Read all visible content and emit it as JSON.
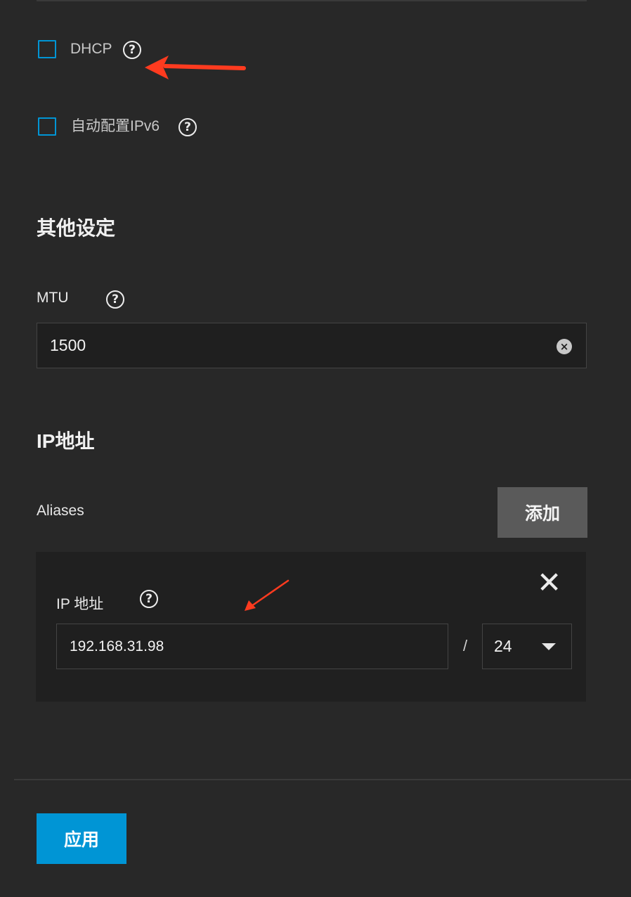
{
  "network": {
    "dhcp": {
      "label": "DHCP",
      "checked": false
    },
    "autoconfig_ipv6": {
      "label": "自动配置IPv6",
      "checked": false
    }
  },
  "other_settings": {
    "title": "其他设定",
    "mtu": {
      "label": "MTU",
      "value": "1500"
    }
  },
  "ip_address": {
    "title": "IP地址",
    "aliases_label": "Aliases",
    "add_label": "添加",
    "alias": {
      "label": "IP 地址",
      "value": "192.168.31.98",
      "separator": "/",
      "netmask": "24"
    }
  },
  "footer": {
    "apply_label": "应用"
  },
  "icons": {
    "help": "help-circle-icon",
    "clear": "clear-circle-icon",
    "close": "close-icon",
    "dropdown": "caret-down-icon"
  },
  "colors": {
    "background": "#282828",
    "accent": "#0095d5",
    "annotation": "#ff3b1f",
    "button_secondary": "#5a5a5a"
  }
}
